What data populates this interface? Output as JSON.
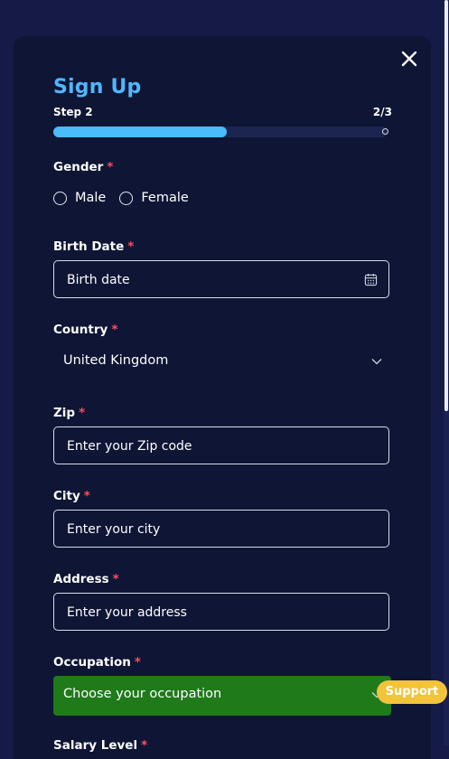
{
  "signup": {
    "title": "Sign Up",
    "step_label": "Step 2",
    "step_count": "2/3",
    "progress": 0.52
  },
  "form": {
    "gender": {
      "label": "Gender",
      "required": "*",
      "options": [
        "Male",
        "Female"
      ]
    },
    "birth_date": {
      "label": "Birth Date",
      "required": "*",
      "placeholder": "Birth date"
    },
    "country": {
      "label": "Country",
      "required": "*",
      "value": "United Kingdom"
    },
    "zip": {
      "label": "Zip",
      "required": "*",
      "placeholder": "Enter your Zip code"
    },
    "city": {
      "label": "City",
      "required": "*",
      "placeholder": "Enter your city"
    },
    "address": {
      "label": "Address",
      "required": "*",
      "placeholder": "Enter your address"
    },
    "occupation": {
      "label": "Occupation",
      "required": "*",
      "value": "Choose your occupation"
    },
    "salary_level": {
      "label": "Salary Level",
      "required": "*"
    }
  },
  "support": {
    "label": "Support"
  },
  "colors": {
    "background": "#151b46",
    "modal": "#0e1535",
    "accent": "#49bcf9",
    "required": "#ff4d5e",
    "occupation_highlight": "#1f7a1a",
    "support": "#f2c43a"
  },
  "icons": [
    "close-icon",
    "calendar-icon",
    "chevron-down-icon"
  ]
}
